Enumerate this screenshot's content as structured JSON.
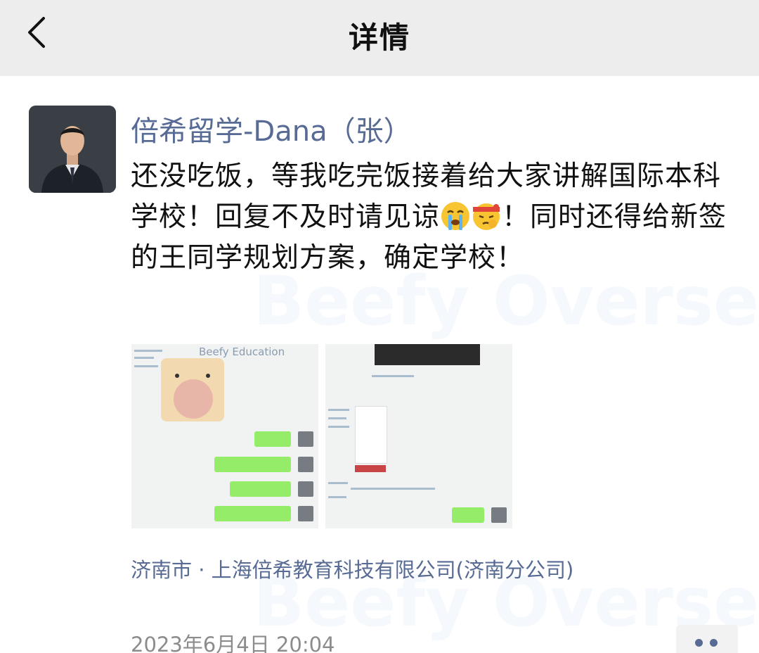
{
  "header": {
    "title": "详情",
    "back_icon": "chevron-left-icon"
  },
  "post": {
    "author": "倍希留学-Dana（张）",
    "text_part1": "还没吃饭，等我吃完饭接着给大家讲解国际本科学校！回复不及时请见谅",
    "emoji_1": "crying-face-emoji",
    "emoji_2": "headband-face-emoji",
    "text_part2": "！同时还得给新签的王同学规划方案，确定学校！",
    "images": [
      {
        "name": "chat-screenshot-1",
        "caption": "Beefy Education"
      },
      {
        "name": "chat-screenshot-2",
        "caption": ""
      }
    ],
    "location": "济南市 · 上海倍希教育科技有限公司(济南分公司)",
    "timestamp": "2023年6月4日 20:04",
    "more_icon": "more-dots-icon"
  },
  "watermark": {
    "brand_text": "Beefy Overseas"
  },
  "colors": {
    "header_bg": "#ededed",
    "link_blue": "#576b95",
    "text": "#111111",
    "muted": "#8c8c8c",
    "chat_green": "#95ec69"
  }
}
